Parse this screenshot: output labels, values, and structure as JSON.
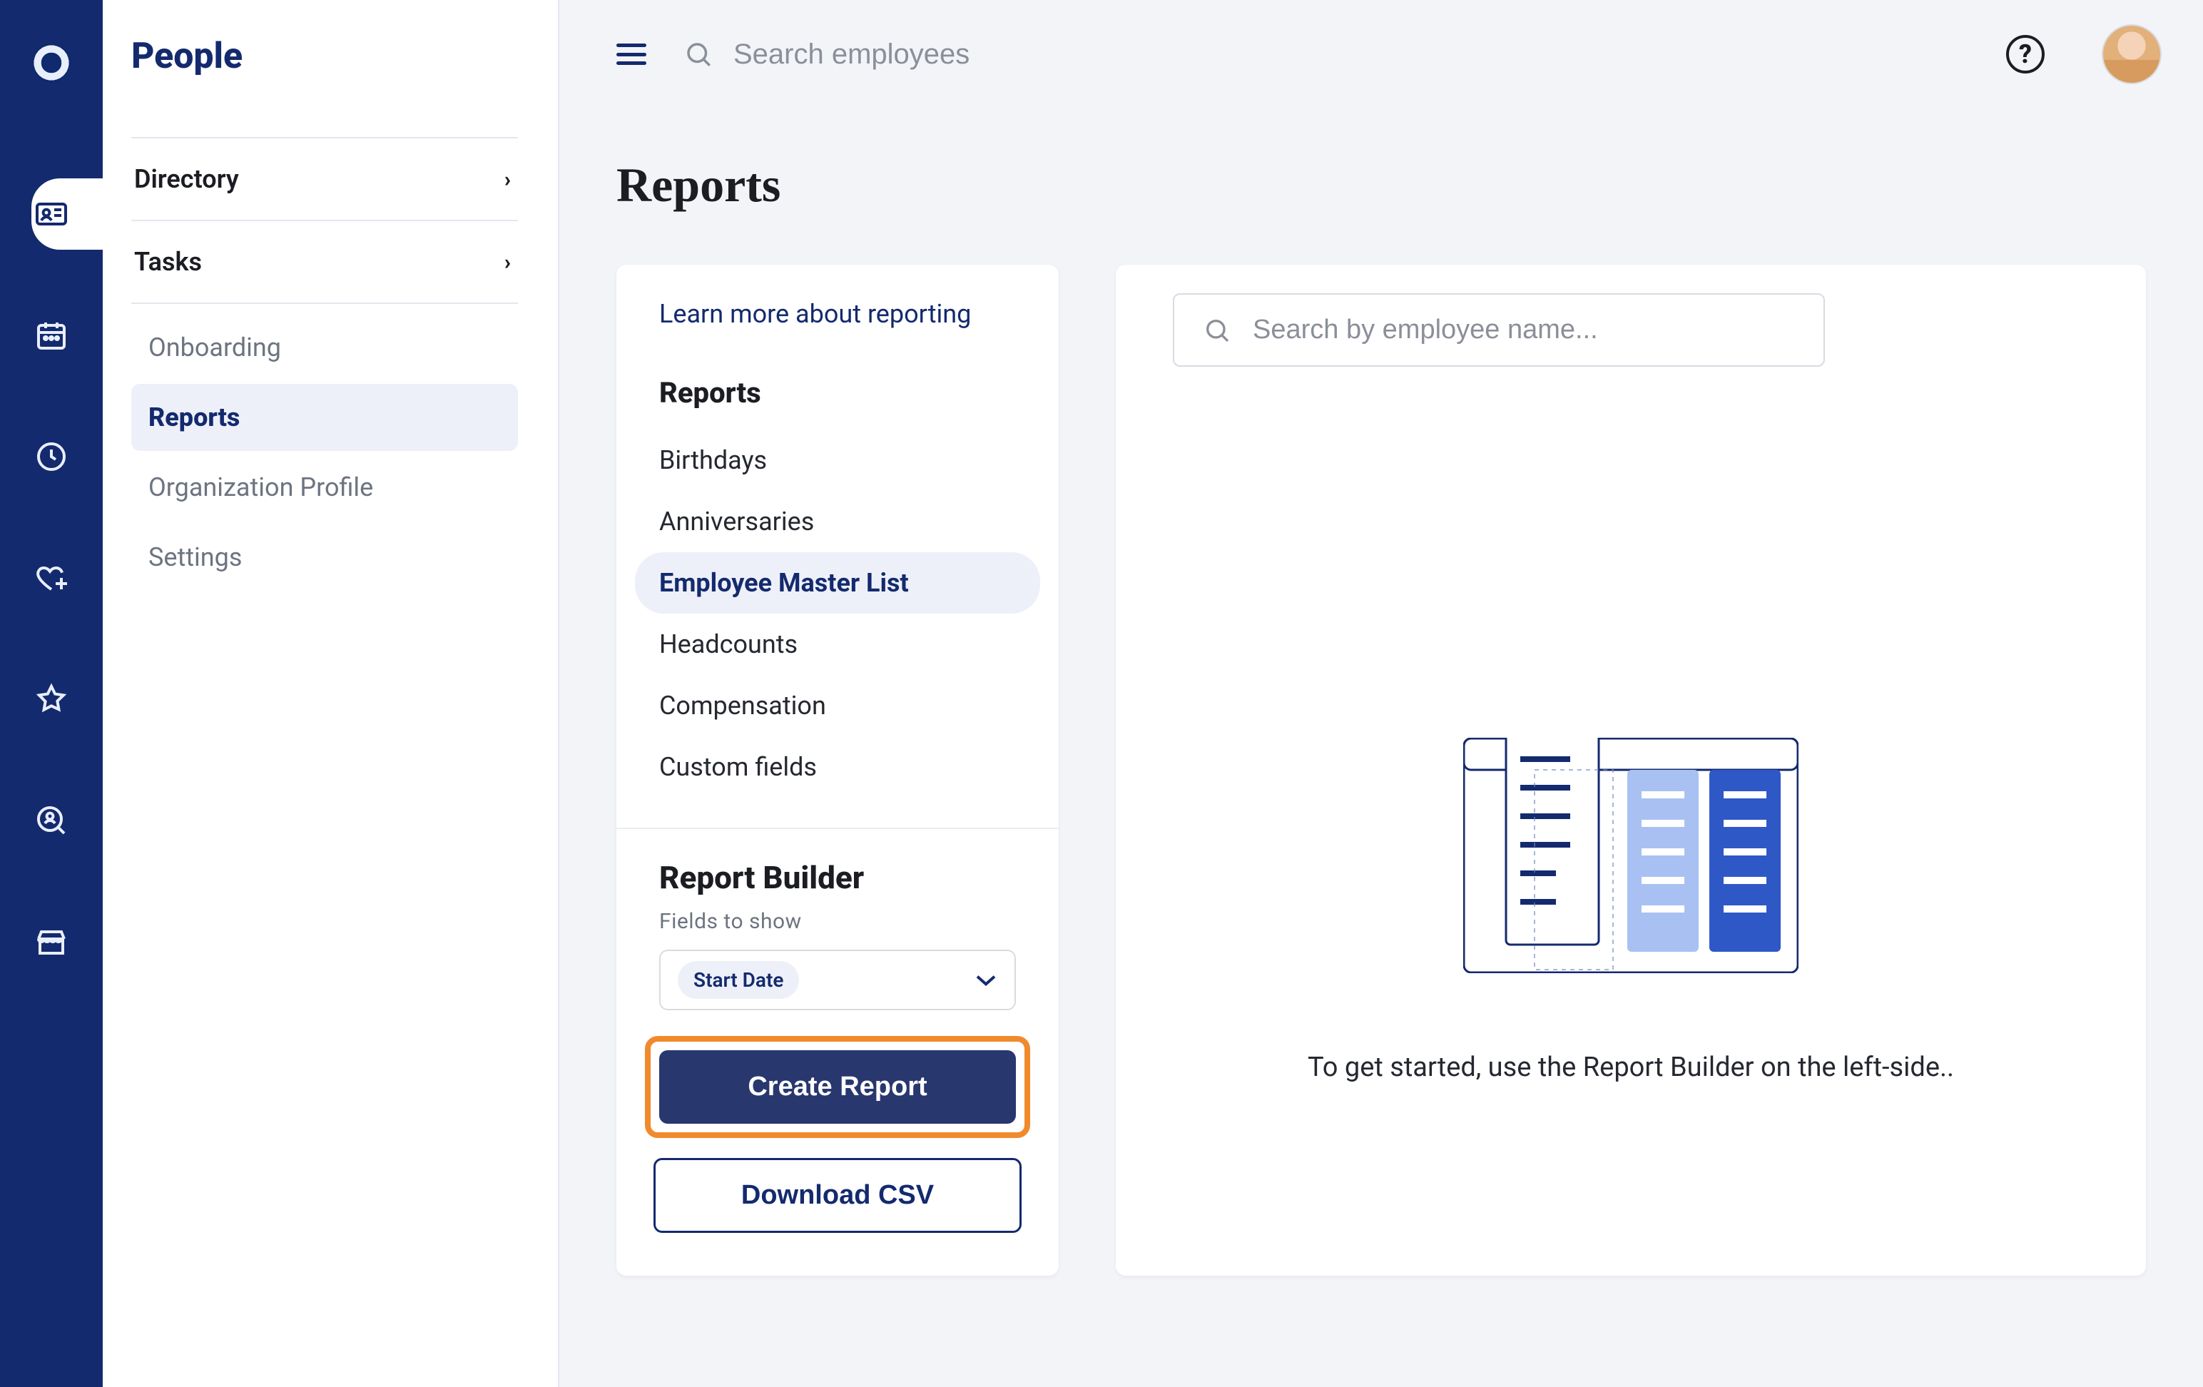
{
  "app_section_title": "People",
  "topbar": {
    "search_placeholder": "Search employees"
  },
  "sidebar": {
    "directory": "Directory",
    "tasks": "Tasks",
    "items": [
      {
        "label": "Onboarding",
        "active": false
      },
      {
        "label": "Reports",
        "active": true
      },
      {
        "label": "Organization Profile",
        "active": false
      },
      {
        "label": "Settings",
        "active": false
      }
    ]
  },
  "page": {
    "title": "Reports"
  },
  "left_card": {
    "learn_link": "Learn more about reporting",
    "reports_heading": "Reports",
    "reports": [
      "Birthdays",
      "Anniversaries",
      "Employee Master List",
      "Headcounts",
      "Compensation",
      "Custom fields"
    ],
    "active_report_index": 2,
    "builder_heading": "Report Builder",
    "fields_label": "Fields to show",
    "selected_chip": "Start Date",
    "create_btn": "Create Report",
    "download_btn": "Download CSV"
  },
  "right_card": {
    "search_placeholder": "Search by employee name...",
    "hint": "To get started, use the Report Builder on the left-side.."
  }
}
